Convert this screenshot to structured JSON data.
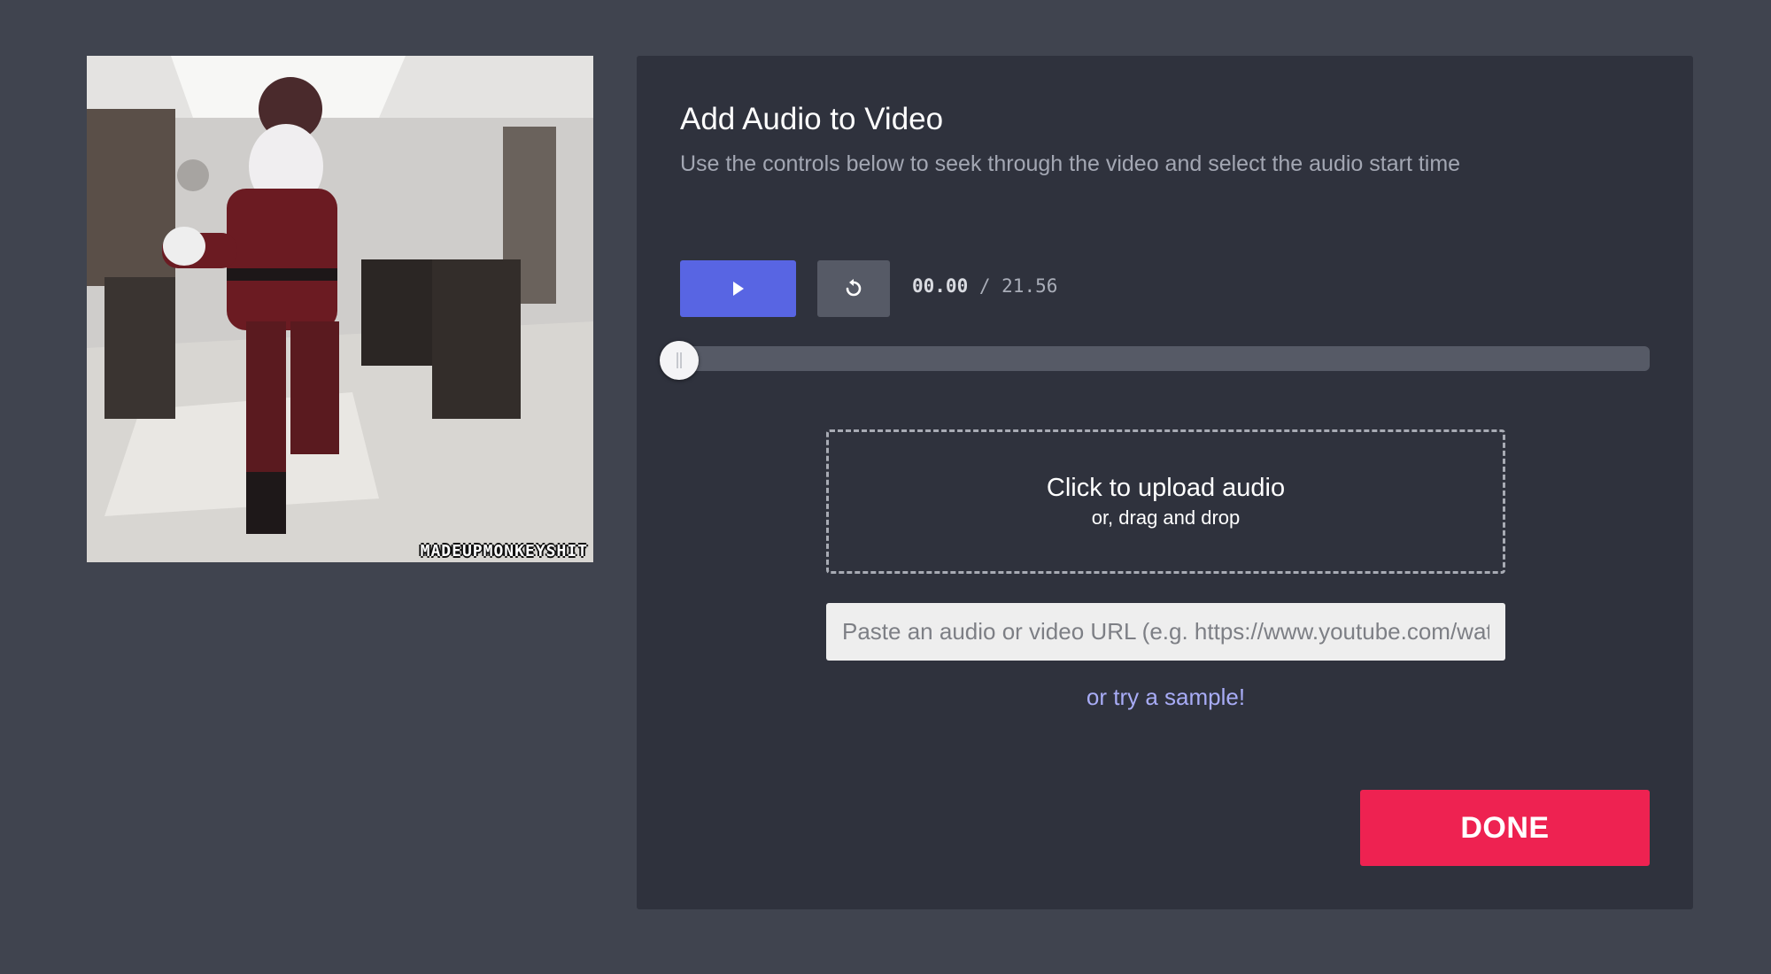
{
  "preview": {
    "watermark": "MADEUPMONKEYSHIT"
  },
  "panel": {
    "title": "Add Audio to Video",
    "subtitle": "Use the controls below to seek through the video and select the audio start time"
  },
  "controls": {
    "play_icon": "play-icon",
    "reset_icon": "reset-icon",
    "current_time": "00.00",
    "separator": " / ",
    "duration": "21.56",
    "seek_progress": 0
  },
  "upload": {
    "main_text": "Click to upload audio",
    "sub_text": "or, drag and drop"
  },
  "url_input": {
    "placeholder": "Paste an audio or video URL (e.g. https://www.youtube.com/watch?v=...)",
    "value": ""
  },
  "sample_link": "or try a sample!",
  "done_button": "DONE",
  "colors": {
    "background": "#40444f",
    "panel": "#2f323d",
    "play_button": "#5865e3",
    "secondary_button": "#565a66",
    "done_button": "#ee2251",
    "link": "#a8acf6"
  }
}
